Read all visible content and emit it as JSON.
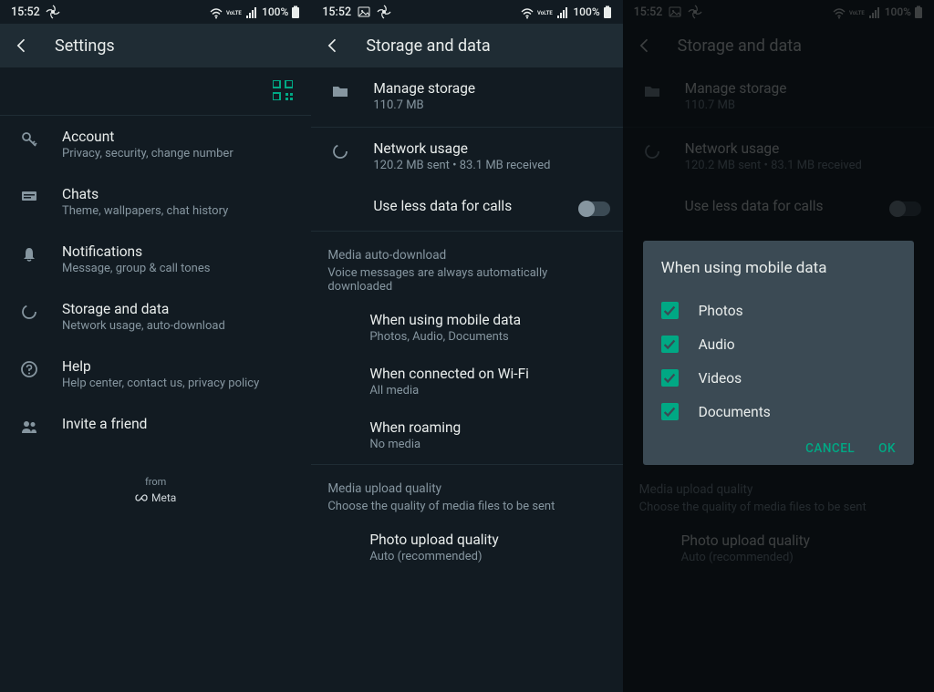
{
  "status": {
    "time": "15:52",
    "battery": "100%"
  },
  "screen1": {
    "title": "Settings",
    "items": [
      {
        "title": "Account",
        "sub": "Privacy, security, change number"
      },
      {
        "title": "Chats",
        "sub": "Theme, wallpapers, chat history"
      },
      {
        "title": "Notifications",
        "sub": "Message, group & call tones"
      },
      {
        "title": "Storage and data",
        "sub": "Network usage, auto-download"
      },
      {
        "title": "Help",
        "sub": "Help center, contact us, privacy policy"
      },
      {
        "title": "Invite a friend",
        "sub": ""
      }
    ],
    "from": "from",
    "meta": "Meta"
  },
  "screen2": {
    "title": "Storage and data",
    "manage": {
      "title": "Manage storage",
      "sub": "110.7 MB"
    },
    "network": {
      "title": "Network usage",
      "sub": "120.2 MB sent • 83.1 MB received"
    },
    "lessdata": "Use less data for calls",
    "media_hdr": "Media auto-download",
    "media_sub": "Voice messages are always automatically downloaded",
    "opts": [
      {
        "title": "When using mobile data",
        "sub": "Photos, Audio, Documents"
      },
      {
        "title": "When connected on Wi-Fi",
        "sub": "All media"
      },
      {
        "title": "When roaming",
        "sub": "No media"
      }
    ],
    "upload_hdr": "Media upload quality",
    "upload_sub": "Choose the quality of media files to be sent",
    "photo": {
      "title": "Photo upload quality",
      "sub": "Auto (recommended)"
    }
  },
  "dialog": {
    "title": "When using mobile data",
    "opts": [
      "Photos",
      "Audio",
      "Videos",
      "Documents"
    ],
    "cancel": "CANCEL",
    "ok": "OK"
  }
}
